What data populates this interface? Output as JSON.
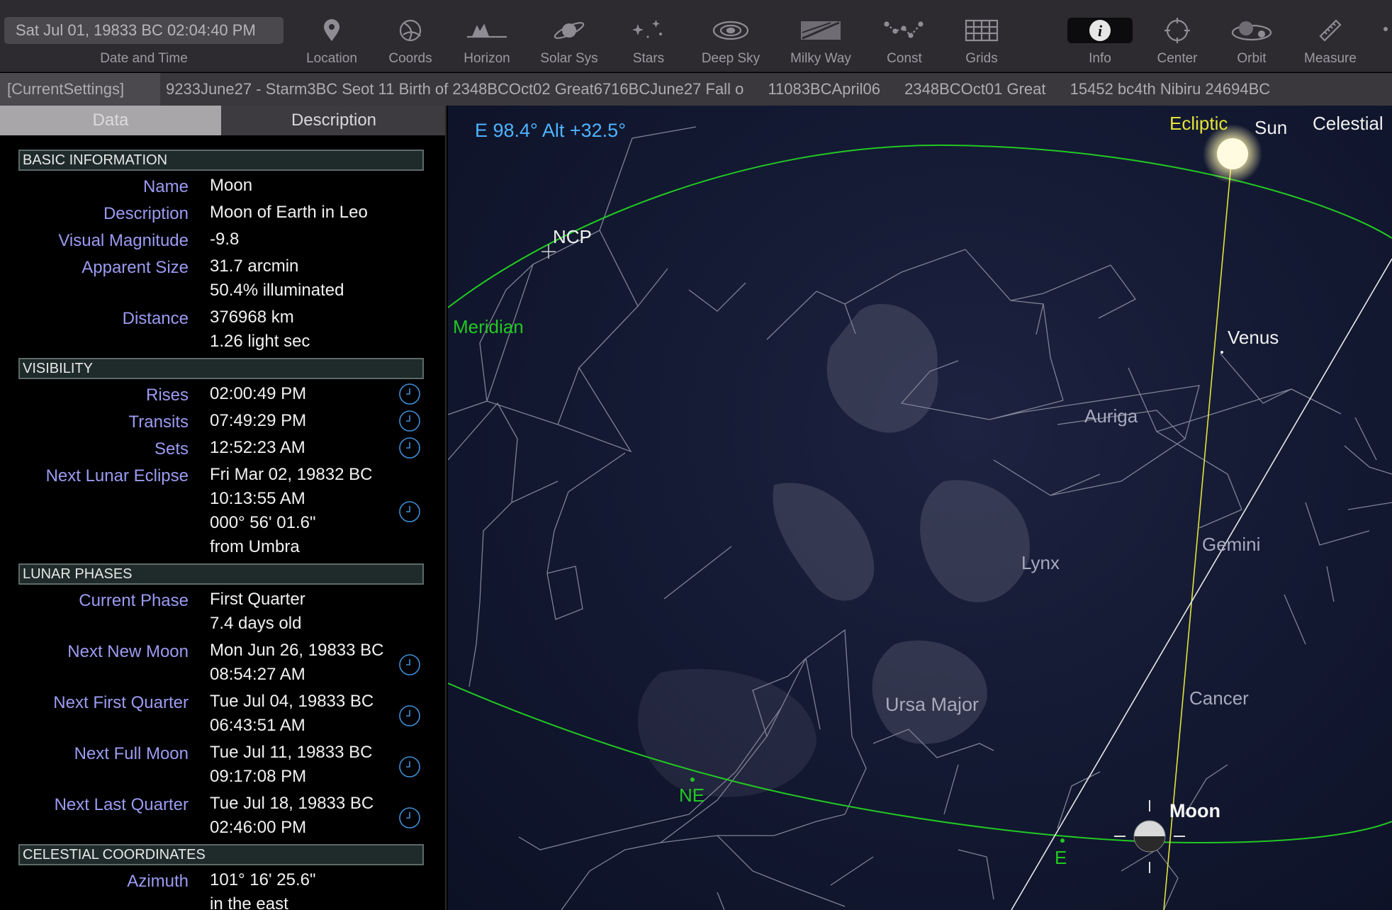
{
  "toolbar": {
    "datetime": "Sat Jul 01, 19833 BC 02:04:40 PM",
    "datetime_label": "Date and Time",
    "tools": [
      {
        "label": "Location",
        "icon": "location-pin-icon"
      },
      {
        "label": "Coords",
        "icon": "coords-icon"
      },
      {
        "label": "Horizon",
        "icon": "horizon-icon"
      },
      {
        "label": "Solar Sys",
        "icon": "planet-icon"
      },
      {
        "label": "Stars",
        "icon": "stars-icon"
      },
      {
        "label": "Deep Sky",
        "icon": "galaxy-icon"
      },
      {
        "label": "Milky Way",
        "icon": "milky-way-icon"
      },
      {
        "label": "Const",
        "icon": "constellation-icon"
      },
      {
        "label": "Grids",
        "icon": "grid-icon"
      },
      {
        "label": "Info",
        "icon": "info-icon"
      },
      {
        "label": "Center",
        "icon": "center-icon"
      },
      {
        "label": "Orbit",
        "icon": "orbit-icon"
      },
      {
        "label": "Measure",
        "icon": "ruler-icon"
      }
    ]
  },
  "settings_strip": {
    "current": "[CurrentSettings]",
    "items": [
      "9233June27 - Starm3BC Seot 11 Birth of 2348BCOct02 Great6716BCJune27 Fall o",
      "11083BCApril06",
      "2348BCOct01 Great",
      "15452 bc4th Nibiru 24694BC"
    ]
  },
  "panel": {
    "tabs": {
      "data": "Data",
      "description": "Description"
    },
    "sections": {
      "basic": "BASIC INFORMATION",
      "visibility": "VISIBILITY",
      "lunar": "LUNAR PHASES",
      "celestial": "CELESTIAL COORDINATES"
    },
    "basic": {
      "name_label": "Name",
      "name": "Moon",
      "desc_label": "Description",
      "desc": "Moon of Earth in Leo",
      "mag_label": "Visual Magnitude",
      "mag": "-9.8",
      "size_label": "Apparent Size",
      "size": "31.7 arcmin",
      "illum": "50.4% illuminated",
      "dist_label": "Distance",
      "dist_km": "376968 km",
      "dist_ls": "1.26 light sec"
    },
    "visibility": {
      "rises_label": "Rises",
      "rises": "02:00:49 PM",
      "transits_label": "Transits",
      "transits": "07:49:29 PM",
      "sets_label": "Sets",
      "sets": "12:52:23 AM",
      "eclipse_label": "Next Lunar Eclipse",
      "eclipse_1": "Fri Mar 02, 19832 BC",
      "eclipse_2": "10:13:55 AM",
      "eclipse_3": "000° 56' 01.6\"",
      "eclipse_4": "from Umbra"
    },
    "lunar": {
      "phase_label": "Current Phase",
      "phase": "First Quarter",
      "age": "7.4 days old",
      "new_label": "Next New Moon",
      "new_1": "Mon Jun 26, 19833 BC",
      "new_2": "08:54:27 AM",
      "first_label": "Next First Quarter",
      "first_1": "Tue Jul 04, 19833 BC",
      "first_2": "06:43:51 AM",
      "full_label": "Next Full Moon",
      "full_1": "Tue Jul 11, 19833 BC",
      "full_2": "09:17:08 PM",
      "last_label": "Next Last Quarter",
      "last_1": "Tue Jul 18, 19833 BC",
      "last_2": "02:46:00 PM"
    },
    "celestial": {
      "az_label": "Azimuth",
      "az": "101° 16' 25.6\"",
      "az_dir": "in the east"
    }
  },
  "sky": {
    "view_readout": "E 98.4° Alt +32.5°",
    "labels": {
      "ecliptic": "Ecliptic",
      "sun": "Sun",
      "celestial": "Celestial",
      "ncp": "NCP",
      "meridian": "Meridian",
      "venus": "Venus",
      "auriga": "Auriga",
      "lynx": "Lynx",
      "gemini": "Gemini",
      "ursa_major": "Ursa Major",
      "cancer": "Cancer",
      "ne": "NE",
      "e": "E",
      "moon": "Moon"
    },
    "colors": {
      "meridian": "#22c922",
      "ecliptic": "#e3e33a",
      "readout": "#4fb3ff",
      "constellation_name": "#a7a9bd"
    }
  }
}
